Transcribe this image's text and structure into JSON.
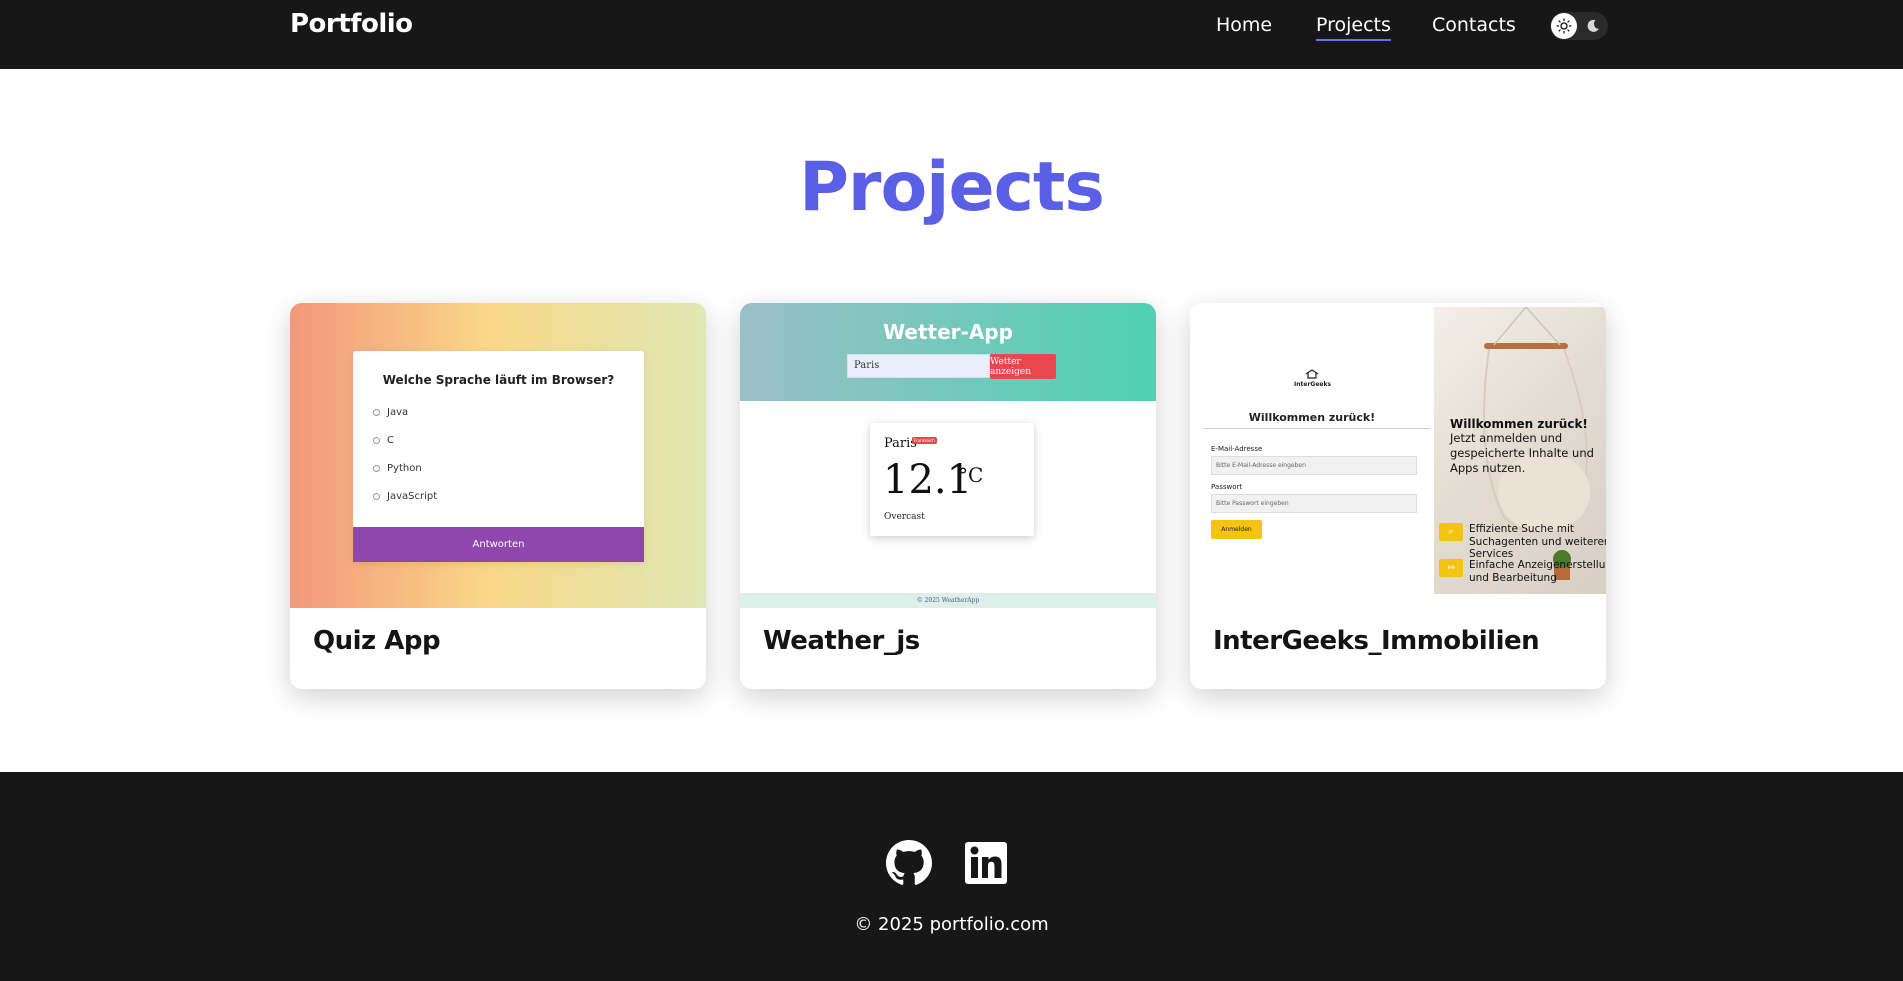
{
  "header": {
    "brand": "Portfolio",
    "nav": [
      {
        "label": "Home"
      },
      {
        "label": "Projects",
        "active": true
      },
      {
        "label": "Contacts"
      }
    ],
    "theme_toggle": {
      "icons": [
        "sun-icon",
        "moon-icon"
      ]
    }
  },
  "main": {
    "title": "Projects",
    "projects": [
      {
        "title": "Quiz App",
        "preview": {
          "question": "Welche Sprache läuft im Browser?",
          "options": [
            "Java",
            "C",
            "Python",
            "JavaScript"
          ],
          "button": "Antworten"
        }
      },
      {
        "title": "Weather_js",
        "preview": {
          "app_title": "Wetter-App",
          "input_value": "Paris",
          "button": "Wetter anzeigen",
          "city": "Paris",
          "badge": "Frankreich",
          "temperature": "12.1",
          "unit": "°C",
          "condition": "Overcast",
          "footer": "© 2025 WeatherApp"
        }
      },
      {
        "title": "InterGeeks_Immobilien",
        "preview": {
          "logo": "InterGeeks",
          "welcome": "Willkommen zurück!",
          "email_label": "E-Mail-Adresse",
          "email_placeholder": "Bitte E-Mail-Adresse eingeben",
          "password_label": "Passwort",
          "password_placeholder": "Bitte Passwort eingeben",
          "button": "Anmelden",
          "headline": "Willkommen zurück!",
          "subtext": "Jetzt anmelden und gespeicherte Inhalte und Apps nutzen.",
          "features": [
            "Effiziente Suche mit Suchagenten und weiteren Services",
            "Einfache Anzeigenerstellung und Bearbeitung"
          ]
        }
      }
    ]
  },
  "footer": {
    "social": [
      "github-icon",
      "linkedin-icon"
    ],
    "copyright": "© 2025 portfolio.com"
  },
  "colors": {
    "accent": "#5b5fe6",
    "header_bg": "#171717",
    "footer_bg": "#171717"
  }
}
